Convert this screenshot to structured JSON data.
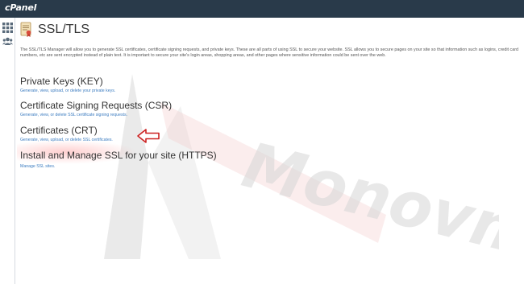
{
  "app": {
    "logo": "cPanel"
  },
  "page": {
    "title": "SSL/TLS",
    "description": "The SSL/TLS Manager will allow you to generate SSL certificates, certificate signing requests, and private keys. These are all parts of using SSL to secure your website. SSL allows you to secure pages on your site so that information such as logins, credit card numbers, etc are sent encrypted instead of plain text. It is important to secure your site's login areas, shopping areas, and other pages where sensitive information could be sent over the web."
  },
  "sections": [
    {
      "title": "Private Keys (KEY)",
      "desc": "Generate, view, upload, or delete your private keys."
    },
    {
      "title": "Certificate Signing Requests (CSR)",
      "desc": "Generate, view, or delete SSL certificate signing requests."
    },
    {
      "title": "Certificates (CRT)",
      "desc": "Generate, view, upload, or delete SSL certificates."
    },
    {
      "title": "Install and Manage SSL for your site (HTTPS)",
      "desc": "Manage SSL sites."
    }
  ],
  "watermark": {
    "text": "Monovm"
  },
  "colors": {
    "topbar": "#293a4a",
    "link": "#3c7cc0",
    "arrow": "#cc2222"
  },
  "icons": {
    "sidebar": [
      "grid-icon",
      "users-icon"
    ],
    "title": "certificate-icon",
    "pointer": "arrow-left-icon"
  }
}
